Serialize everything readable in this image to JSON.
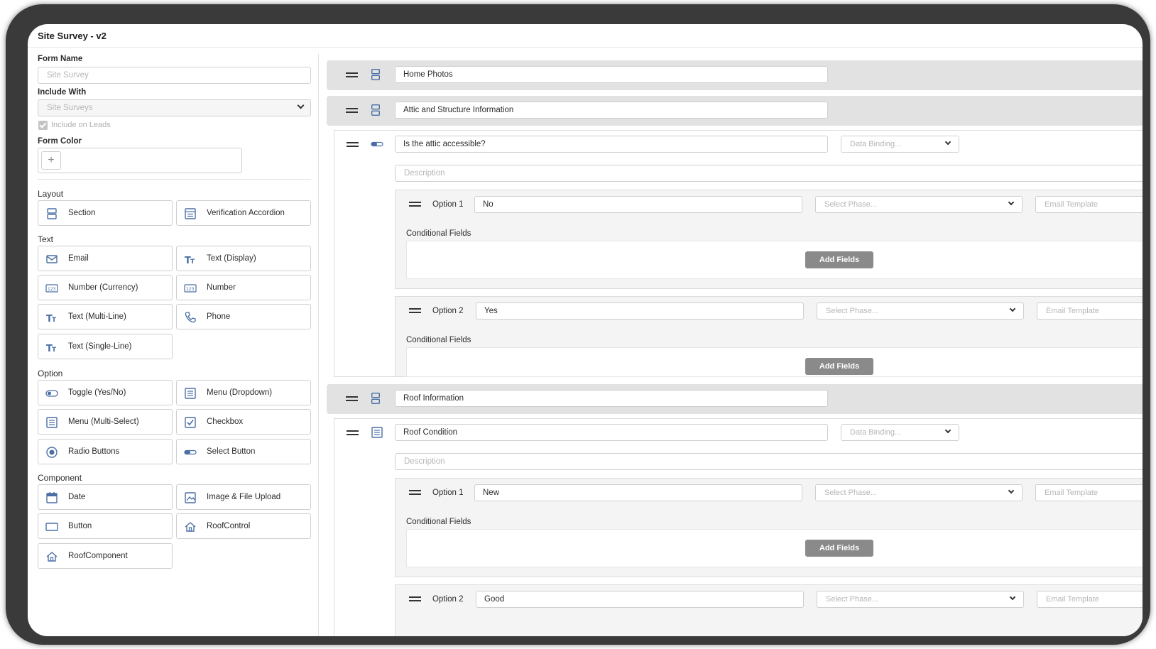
{
  "window": {
    "title": "Site Survey - v2"
  },
  "form": {
    "name_label": "Form Name",
    "name_placeholder": "Site Survey",
    "include_with_label": "Include With",
    "include_with_value": "Site Surveys",
    "include_on_leads_label": "Include on Leads",
    "include_on_leads_checked": true,
    "color_label": "Form Color",
    "color_add": "+"
  },
  "palette": {
    "layout": {
      "title": "Layout",
      "items": [
        "Section",
        "Verification Accordion"
      ]
    },
    "text": {
      "title": "Text",
      "items": [
        "Email",
        "Text (Display)",
        "Number (Currency)",
        "Number",
        "Text (Multi-Line)",
        "Phone",
        "Text (Single-Line)"
      ]
    },
    "option": {
      "title": "Option",
      "items": [
        "Toggle (Yes/No)",
        "Menu (Dropdown)",
        "Menu (Multi-Select)",
        "Checkbox",
        "Radio Buttons",
        "Select Button"
      ]
    },
    "component": {
      "title": "Component",
      "items": [
        "Date",
        "Image & File Upload",
        "Button",
        "RoofControl",
        "RoofComponent"
      ]
    }
  },
  "canvas": {
    "sections": [
      "Home Photos",
      "Attic and Structure Information",
      "Roof Information"
    ],
    "fields": [
      {
        "question": "Is the attic accessible?",
        "data_binding_placeholder": "Data Binding...",
        "description_placeholder": "Description",
        "options": [
          {
            "label": "Option 1",
            "value": "No",
            "phase_placeholder": "Select Phase...",
            "email_placeholder": "Email Template",
            "conditional_label": "Conditional Fields",
            "add_fields": "Add Fields"
          },
          {
            "label": "Option 2",
            "value": "Yes",
            "phase_placeholder": "Select Phase...",
            "email_placeholder": "Email Template",
            "conditional_label": "Conditional Fields",
            "add_fields": "Add Fields"
          }
        ]
      },
      {
        "question": "Roof Condition",
        "data_binding_placeholder": "Data Binding...",
        "description_placeholder": "Description",
        "options": [
          {
            "label": "Option 1",
            "value": "New",
            "phase_placeholder": "Select Phase...",
            "email_placeholder": "Email Template",
            "conditional_label": "Conditional Fields",
            "add_fields": "Add Fields"
          },
          {
            "label": "Option 2",
            "value": "Good",
            "phase_placeholder": "Select Phase...",
            "email_placeholder": "Email Template"
          }
        ]
      }
    ]
  },
  "colors": {
    "accent_icon": "#4a6fa5",
    "button_grey": "#8a8a8a",
    "section_bar": "#e2e2e2"
  }
}
